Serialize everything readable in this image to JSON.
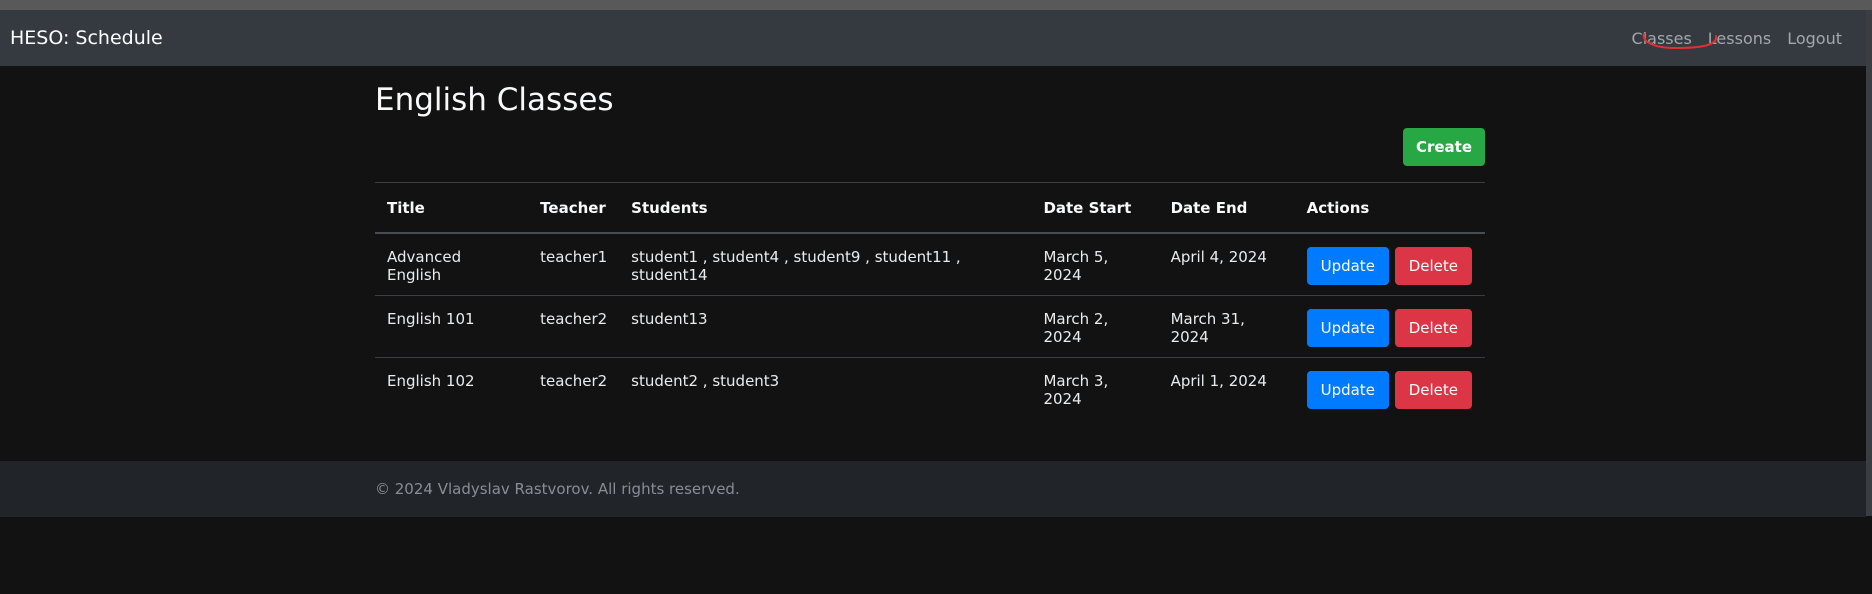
{
  "navbar": {
    "brand": "HESO: Schedule",
    "links": [
      "Classes",
      "Lessons",
      "Logout"
    ],
    "annotation_color": "#e03030"
  },
  "page": {
    "title": "English Classes",
    "create_label": "Create"
  },
  "table": {
    "headers": [
      "Title",
      "Teacher",
      "Students",
      "Date Start",
      "Date End",
      "Actions"
    ],
    "rows": [
      {
        "title": "Advanced English",
        "teacher": "teacher1",
        "students": "student1 , student4 , student9 , student11 , student14",
        "date_start": "March 5, 2024",
        "date_end": "April 4, 2024",
        "update": "Update",
        "delete": "Delete"
      },
      {
        "title": "English 101",
        "teacher": "teacher2",
        "students": "student13",
        "date_start": "March 2, 2024",
        "date_end": "March 31, 2024",
        "update": "Update",
        "delete": "Delete"
      },
      {
        "title": "English 102",
        "teacher": "teacher2",
        "students": "student2 , student3",
        "date_start": "March 3, 2024",
        "date_end": "April 1, 2024",
        "update": "Update",
        "delete": "Delete"
      }
    ]
  },
  "footer": {
    "text": "© 2024 Vladyslav Rastvorov. All rights reserved."
  },
  "colors": {
    "create": "#28a745",
    "update": "#007bff",
    "delete": "#dc3545",
    "navbar": "#343a40",
    "background": "#121212"
  }
}
